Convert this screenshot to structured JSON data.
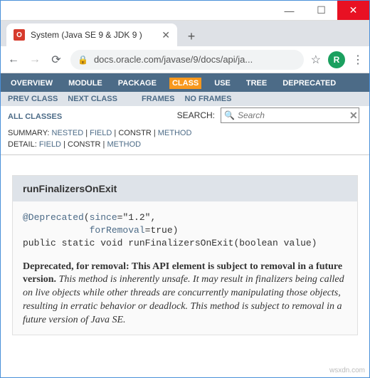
{
  "window": {
    "close": "✕",
    "min": "—",
    "max": "☐"
  },
  "tab": {
    "favicon_letter": "O",
    "title": "System (Java SE 9 & JDK 9 )",
    "close": "✕"
  },
  "newtab": "+",
  "nav": {
    "back": "←",
    "fwd": "→",
    "reload": "⟳"
  },
  "url": {
    "lock": "🔒",
    "text": "docs.oracle.com/javase/9/docs/api/ja..."
  },
  "star": "☆",
  "avatar": "R",
  "menu": "⋮",
  "topnav": {
    "overview": "OVERVIEW",
    "module": "MODULE",
    "package": "PACKAGE",
    "class": "CLASS",
    "use": "USE",
    "tree": "TREE",
    "deprecated": "DEPRECATED"
  },
  "subnav": {
    "prev": "PREV CLASS",
    "next": "NEXT CLASS",
    "frames": "FRAMES",
    "noframes": "NO FRAMES"
  },
  "allclasses": "ALL CLASSES",
  "search": {
    "label": "SEARCH:",
    "placeholder": "Search",
    "icon": "🔍",
    "clear": "✕"
  },
  "summary": {
    "label": "SUMMARY:",
    "nested": "NESTED",
    "field": "FIELD",
    "constr": "CONSTR",
    "method": "METHOD"
  },
  "detail": {
    "label": "DETAIL:",
    "field": "FIELD",
    "constr": "CONSTR",
    "method": "METHOD"
  },
  "method": {
    "name": "runFinalizersOnExit",
    "sig1": "@Deprecated(since=\"1.2\",",
    "sig2": "            forRemoval=true)",
    "sig3": "public static void runFinalizersOnExit(boolean value)",
    "sig_link1": "@Deprecated",
    "sig_link2": "since",
    "sig_link3": "forRemoval",
    "deprec_lead": "Deprecated, for removal: This API element is subject to removal in a future version.",
    "deprec_desc": " This method is inherently unsafe. It may result in finalizers being called on live objects while other threads are concurrently manipulating those objects, resulting in erratic behavior or deadlock. This method is subject to removal in a future version of Java SE."
  },
  "watermark": "wsxdn.com"
}
